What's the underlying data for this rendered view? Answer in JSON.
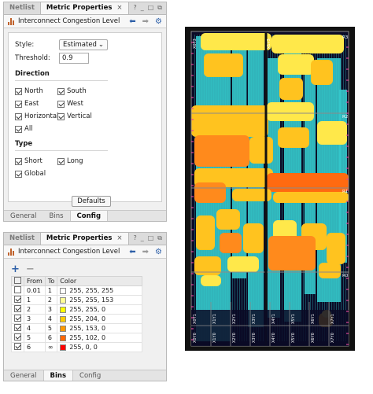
{
  "top_panel": {
    "tabs": [
      "Netlist",
      "Metric Properties"
    ],
    "tab_close": "×",
    "window_controls": [
      "?",
      "_",
      "□",
      "⧉"
    ],
    "title": "Interconnect Congestion Level",
    "nav": {
      "back": "⬅",
      "forward": "➡",
      "settings": "⚙"
    },
    "style_label": "Style:",
    "style_value": "Estimated",
    "threshold_label": "Threshold:",
    "threshold_value": "0.9",
    "direction_title": "Direction",
    "directions": [
      {
        "label": "North",
        "checked": true
      },
      {
        "label": "South",
        "checked": true
      },
      {
        "label": "East",
        "checked": true
      },
      {
        "label": "West",
        "checked": true
      },
      {
        "label": "Horizontal",
        "checked": true
      },
      {
        "label": "Vertical",
        "checked": true
      },
      {
        "label": "All",
        "checked": true
      }
    ],
    "type_title": "Type",
    "types": [
      {
        "label": "Short",
        "checked": true
      },
      {
        "label": "Long",
        "checked": true
      },
      {
        "label": "Global",
        "checked": true
      }
    ],
    "defaults_label": "Defaults",
    "bottom_tabs": [
      "General",
      "Bins",
      "Config"
    ],
    "active_bottom_tab": "Config"
  },
  "bottom_panel": {
    "tabs": [
      "Netlist",
      "Metric Properties"
    ],
    "tab_close": "×",
    "window_controls": [
      "?",
      "_",
      "□",
      "⧉"
    ],
    "title": "Interconnect Congestion Level",
    "nav": {
      "back": "⬅",
      "forward": "➡",
      "settings": "⚙"
    },
    "add_label": "+",
    "remove_label": "−",
    "columns": [
      "",
      "From",
      "To",
      "Color"
    ],
    "bins": [
      {
        "checked": false,
        "from": "0.01",
        "to": "1",
        "color": "#ffffff",
        "rgb": "255, 255, 255"
      },
      {
        "checked": true,
        "from": "1",
        "to": "2",
        "color": "#ffff99",
        "rgb": "255, 255, 153"
      },
      {
        "checked": true,
        "from": "2",
        "to": "3",
        "color": "#ffff00",
        "rgb": "255, 255, 0"
      },
      {
        "checked": true,
        "from": "3",
        "to": "4",
        "color": "#ffcc00",
        "rgb": "255, 204, 0"
      },
      {
        "checked": true,
        "from": "4",
        "to": "5",
        "color": "#ff9900",
        "rgb": "255, 153, 0"
      },
      {
        "checked": true,
        "from": "5",
        "to": "6",
        "color": "#ff6600",
        "rgb": "255, 102, 0"
      },
      {
        "checked": true,
        "from": "6",
        "to": "∞",
        "color": "#ff0000",
        "rgb": "255, 0, 0"
      }
    ],
    "bottom_tabs": [
      "General",
      "Bins",
      "Config"
    ],
    "active_bottom_tab": "Bins"
  },
  "device_view": {
    "region_labels": [
      "R3",
      "R2",
      "R1",
      "R0"
    ],
    "column_labels_top": [
      "X0Y3",
      "X1Y3"
    ],
    "column_labels_bottom": [
      "X0Y0",
      "X1Y0",
      "X2Y0",
      "X3Y0",
      "X4Y0",
      "X5Y0",
      "X6Y0",
      "X7Y0"
    ],
    "column_labels_lower": [
      "X0Y1",
      "X1Y1",
      "X2Y1",
      "X3Y1",
      "X4Y1",
      "X5Y1",
      "X6Y1",
      "X7Y1"
    ],
    "colors": {
      "background": "#0b0b26",
      "routing": "#35c8cc",
      "low": "#ffe84a",
      "mid": "#ffc31f",
      "high": "#ff8a1c",
      "very_high": "#ff6a10",
      "grid": "#8a8a8a",
      "ticks": "#e0469a"
    }
  }
}
